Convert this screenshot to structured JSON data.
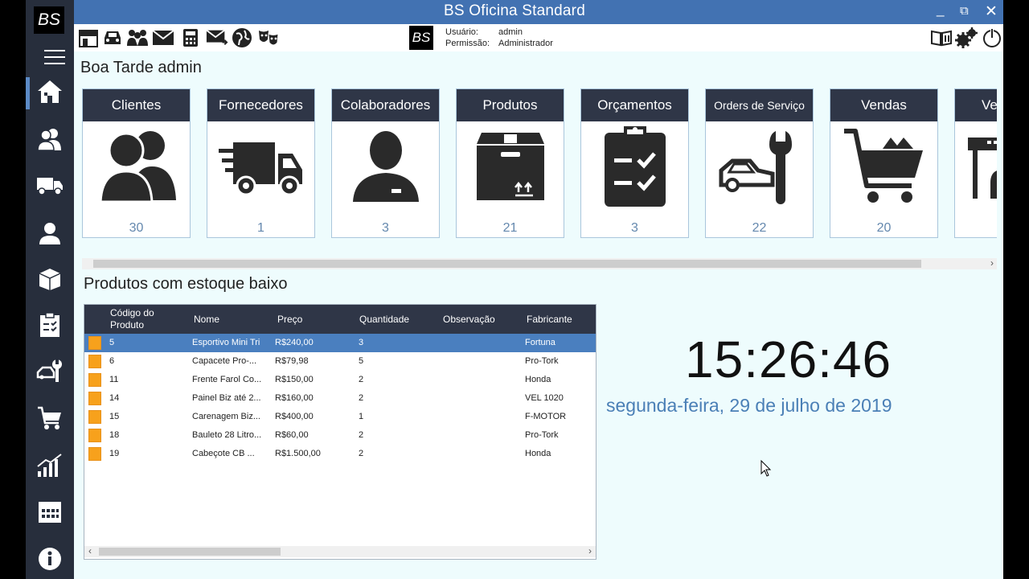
{
  "window": {
    "title": "BS Oficina Standard",
    "minimize": "_",
    "maximize": "⧉",
    "close": "✕"
  },
  "sidebar": {
    "logo": "BS",
    "items": [
      {
        "name": "home"
      },
      {
        "name": "clients"
      },
      {
        "name": "suppliers"
      },
      {
        "name": "collaborators"
      },
      {
        "name": "products"
      },
      {
        "name": "budgets"
      },
      {
        "name": "service-orders"
      },
      {
        "name": "sales"
      },
      {
        "name": "reports"
      },
      {
        "name": "calendar"
      },
      {
        "name": "info"
      }
    ]
  },
  "toolbar": {
    "logo": "BS",
    "user_label": "Usuário:",
    "user_value": "admin",
    "permission_label": "Permissão:",
    "permission_value": "Administrador"
  },
  "greeting": "Boa Tarde admin",
  "tiles": [
    {
      "label": "Clientes",
      "count": "30",
      "icon": "users-icon"
    },
    {
      "label": "Fornecedores",
      "count": "1",
      "icon": "truck-icon"
    },
    {
      "label": "Colaboradores",
      "count": "3",
      "icon": "person-icon"
    },
    {
      "label": "Produtos",
      "count": "21",
      "icon": "box-icon"
    },
    {
      "label": "Orçamentos",
      "count": "3",
      "icon": "clipboard-icon"
    },
    {
      "label": "Orders de Serviço",
      "count": "22",
      "icon": "car-wrench-icon"
    },
    {
      "label": "Vendas",
      "count": "20",
      "icon": "cart-icon"
    },
    {
      "label": "Ve",
      "count": "",
      "icon": "register-icon"
    }
  ],
  "low_stock": {
    "title": "Produtos com estoque baixo",
    "columns": [
      "Código do Produto",
      "Nome",
      "Preço",
      "Quantidade",
      "Observação",
      "Fabricante"
    ],
    "rows": [
      {
        "codigo": "5",
        "nome": "Esportivo Mini Tri",
        "preco": "R$240,00",
        "quantidade": "3",
        "observacao": "",
        "fabricante": "Fortuna"
      },
      {
        "codigo": "6",
        "nome": "Capacete Pro-...",
        "preco": "R$79,98",
        "quantidade": "5",
        "observacao": "",
        "fabricante": "Pro-Tork"
      },
      {
        "codigo": "11",
        "nome": "Frente Farol Co...",
        "preco": "R$150,00",
        "quantidade": "2",
        "observacao": "",
        "fabricante": "Honda"
      },
      {
        "codigo": "14",
        "nome": "Painel Biz até 2...",
        "preco": "R$160,00",
        "quantidade": "2",
        "observacao": "",
        "fabricante": "VEL 1020"
      },
      {
        "codigo": "15",
        "nome": "Carenagem Biz...",
        "preco": "R$400,00",
        "quantidade": "1",
        "observacao": "",
        "fabricante": "F-MOTOR"
      },
      {
        "codigo": "18",
        "nome": "Bauleto 28 Litro...",
        "preco": "R$60,00",
        "quantidade": "2",
        "observacao": "",
        "fabricante": "Pro-Tork"
      },
      {
        "codigo": "19",
        "nome": "Cabeçote CB ...",
        "preco": "R$1.500,00",
        "quantidade": "2",
        "observacao": "",
        "fabricante": "Honda"
      }
    ],
    "selected_row": 0
  },
  "clock": {
    "time": "15:26:46",
    "date": "segunda-feira, 29 de julho de 2019"
  },
  "colors": {
    "titlebar": "#4272b2",
    "sidebar": "#272e3c",
    "tile_header": "#2f3647",
    "accent": "#4a7fbf",
    "count": "#6488ae",
    "row_marker": "#f7a11c"
  }
}
